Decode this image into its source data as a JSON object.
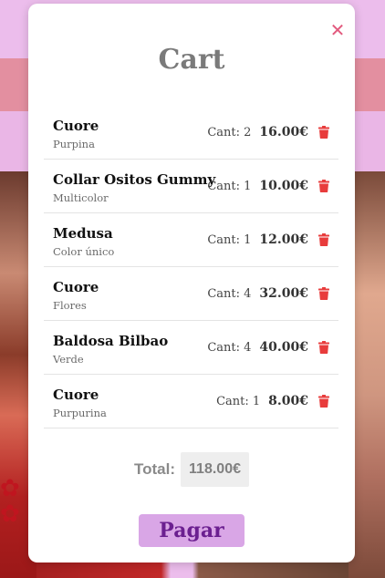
{
  "cart": {
    "title": "Cart",
    "close_icon": "✕",
    "items": [
      {
        "name": "Cuore",
        "variant": "Purpina",
        "qty": "Cant: 2",
        "price": "16.00€"
      },
      {
        "name": "Collar Ositos Gummy",
        "variant": "Multicolor",
        "qty": "Cant: 1",
        "price": "10.00€"
      },
      {
        "name": "Medusa",
        "variant": "Color único",
        "qty": "Cant: 1",
        "price": "12.00€"
      },
      {
        "name": "Cuore",
        "variant": "Flores",
        "qty": "Cant: 4",
        "price": "32.00€"
      },
      {
        "name": "Baldosa Bilbao",
        "variant": "Verde",
        "qty": "Cant: 4",
        "price": "40.00€"
      },
      {
        "name": "Cuore",
        "variant": "Purpurina",
        "qty": "Cant: 1",
        "price": "8.00€"
      }
    ],
    "total_label": "Total:",
    "total_value": "118.00€",
    "pay_label": "Pagar"
  },
  "colors": {
    "accent": "#d9a6e6",
    "trash": "#e83c3c",
    "close": "#e25a7e"
  },
  "icons": {
    "close": "close-icon",
    "trash": "trash-icon"
  }
}
